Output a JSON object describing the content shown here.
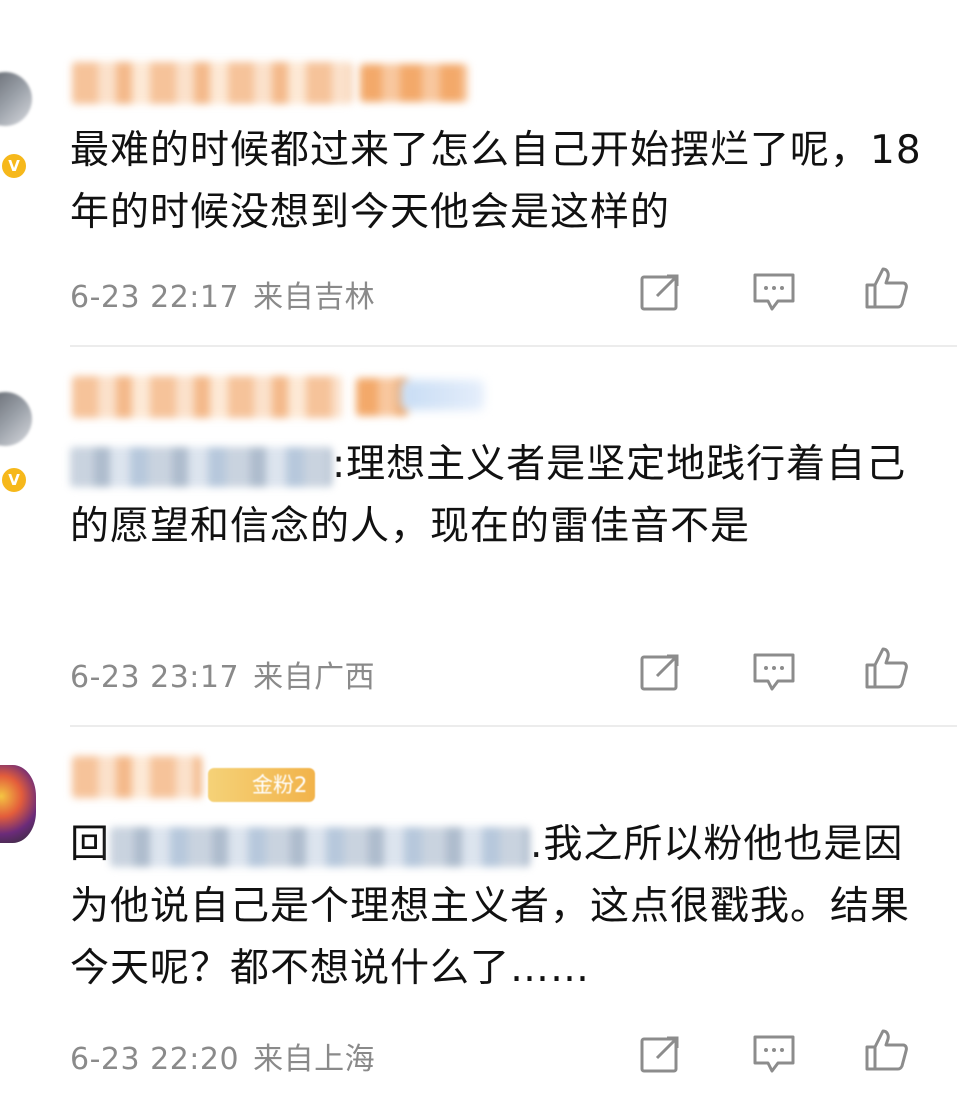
{
  "comments": [
    {
      "text": "最难的时候都过来了怎么自己开始摆烂了呢，18年的时候没想到今天他会是这样的",
      "date": "6-23 22:17",
      "location": "来自吉林",
      "verified_badge": "V"
    },
    {
      "reply_sep": ":",
      "text": "理想主义者是坚定地践行着自己的愿望和信念的人，现在的雷佳音不是",
      "date": "6-23 23:17",
      "location": "来自广西",
      "verified_badge": "V"
    },
    {
      "fan_badge": "金粉2",
      "reply_prefix": "回",
      "reply_sep": ".",
      "text": "我之所以粉他也是因为他说自己是个理想主义者，这点很戳我。结果今天呢？都不想说什么了……",
      "date": "6-23 22:20",
      "location": "来自上海"
    }
  ],
  "icons": {
    "share": "share-icon",
    "comment": "comment-icon",
    "like": "like-icon"
  },
  "colors": {
    "meta_text": "#8a8a8a",
    "icon_stroke": "#8c8c8c",
    "badge": "#f6b81b"
  }
}
